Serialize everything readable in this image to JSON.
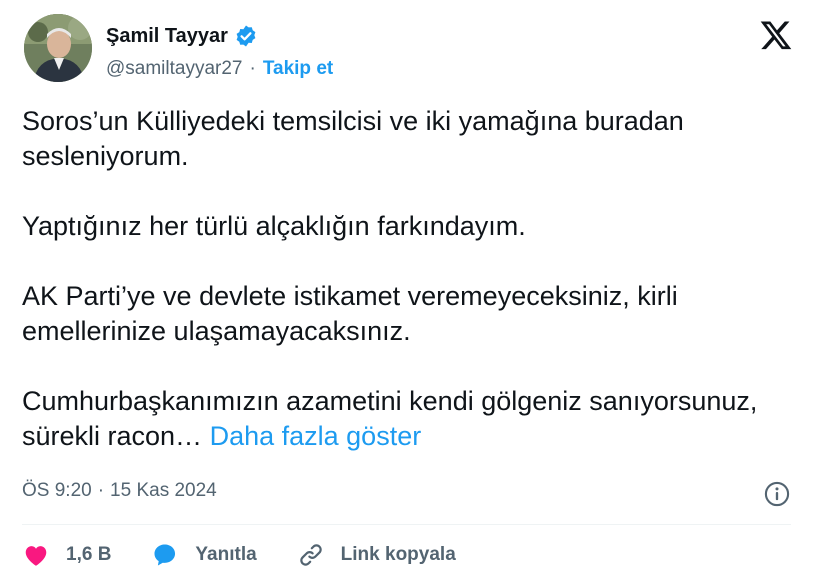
{
  "author": {
    "name": "Şamil Tayyar",
    "handle": "@samiltayyar27",
    "separator": "·",
    "follow_label": "Takip et"
  },
  "tweet": {
    "paragraphs": [
      "Soros’un Külliyedeki temsilcisi ve iki yamağına buradan sesleniyorum.",
      "Yaptığınız her türlü alçaklığın farkındayım.",
      "AK Parti’ye ve devlete istikamet veremeyeceksiniz, kirli emellerinize ulaşamayacaksınız."
    ],
    "truncated_text": "Cumhurbaşkanımızın azametini kendi gölgeniz sanıyorsunuz, sürekli racon…",
    "show_more_label": "Daha fazla göster"
  },
  "meta": {
    "time": "ÖS 9:20",
    "separator": "·",
    "date": "15 Kas 2024"
  },
  "actions": {
    "like_count": "1,6 B",
    "reply_label": "Yanıtla",
    "copy_link_label": "Link kopyala"
  },
  "icons": {
    "verified": "verified-badge-icon",
    "platform": "x-logo-icon",
    "info": "info-icon",
    "like": "heart-icon",
    "reply": "speech-bubble-icon",
    "link": "link-icon"
  },
  "colors": {
    "accent": "#1d9bf0",
    "text": "#0f1419",
    "secondary": "#536471",
    "like": "#f91880"
  }
}
